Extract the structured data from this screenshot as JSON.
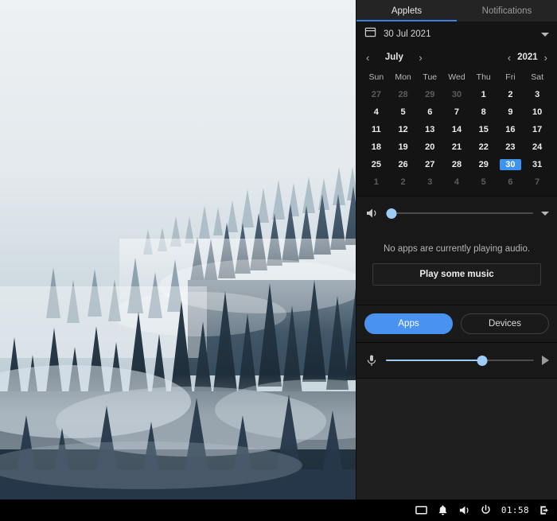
{
  "taskbar": {
    "clock": "01:58",
    "icons": [
      "display-icon",
      "bell-icon",
      "volume-icon",
      "power-icon",
      "logout-icon"
    ]
  },
  "panel": {
    "tabs": [
      {
        "label": "Applets",
        "active": true
      },
      {
        "label": "Notifications",
        "active": false
      }
    ],
    "accent_color": "#3d93f0",
    "calendar": {
      "icon": "calendar-icon",
      "date_label": "30 Jul 2021",
      "month": "July",
      "year": "2021",
      "prev_month": "‹",
      "next_month": "›",
      "prev_year": "‹",
      "next_year": "›",
      "dow": [
        "Sun",
        "Mon",
        "Tue",
        "Wed",
        "Thu",
        "Fri",
        "Sat"
      ],
      "weeks": [
        [
          {
            "d": "27",
            "muted": true
          },
          {
            "d": "28",
            "muted": true
          },
          {
            "d": "29",
            "muted": true
          },
          {
            "d": "30",
            "muted": true
          },
          {
            "d": "1",
            "muted": false
          },
          {
            "d": "2",
            "muted": false
          },
          {
            "d": "3",
            "muted": false
          }
        ],
        [
          {
            "d": "4",
            "muted": false
          },
          {
            "d": "5",
            "muted": false
          },
          {
            "d": "6",
            "muted": false
          },
          {
            "d": "7",
            "muted": false
          },
          {
            "d": "8",
            "muted": false
          },
          {
            "d": "9",
            "muted": false
          },
          {
            "d": "10",
            "muted": false
          }
        ],
        [
          {
            "d": "11",
            "muted": false
          },
          {
            "d": "12",
            "muted": false
          },
          {
            "d": "13",
            "muted": false
          },
          {
            "d": "14",
            "muted": false
          },
          {
            "d": "15",
            "muted": false
          },
          {
            "d": "16",
            "muted": false
          },
          {
            "d": "17",
            "muted": false
          }
        ],
        [
          {
            "d": "18",
            "muted": false
          },
          {
            "d": "19",
            "muted": false
          },
          {
            "d": "20",
            "muted": false
          },
          {
            "d": "21",
            "muted": false
          },
          {
            "d": "22",
            "muted": false
          },
          {
            "d": "23",
            "muted": false
          },
          {
            "d": "24",
            "muted": false
          }
        ],
        [
          {
            "d": "25",
            "muted": false
          },
          {
            "d": "26",
            "muted": false
          },
          {
            "d": "27",
            "muted": false
          },
          {
            "d": "28",
            "muted": false
          },
          {
            "d": "29",
            "muted": false
          },
          {
            "d": "30",
            "muted": false,
            "today": true
          },
          {
            "d": "31",
            "muted": false
          }
        ],
        [
          {
            "d": "1",
            "muted": true
          },
          {
            "d": "2",
            "muted": true
          },
          {
            "d": "3",
            "muted": true
          },
          {
            "d": "4",
            "muted": true
          },
          {
            "d": "5",
            "muted": true
          },
          {
            "d": "6",
            "muted": true
          },
          {
            "d": "7",
            "muted": true
          }
        ]
      ]
    },
    "volume": {
      "icon": "speaker-icon",
      "value_percent": 4,
      "expander_icon": "chevron-down-icon"
    },
    "audio": {
      "empty_message": "No apps are currently playing audio.",
      "action_label": "Play some music"
    },
    "source_toggle": {
      "apps_label": "Apps",
      "devices_label": "Devices",
      "selected": "Apps"
    },
    "microphone": {
      "icon": "microphone-icon",
      "value_percent": 65,
      "test_icon": "play-icon"
    }
  }
}
